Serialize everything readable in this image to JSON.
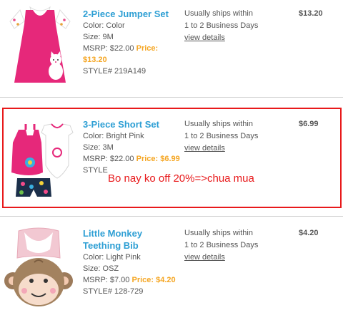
{
  "items": [
    {
      "title": "2-Piece Jumper Set",
      "color": "Color: Color",
      "size": "Size: 9M",
      "msrp": "MSRP: $22.00",
      "price_label": "Price:",
      "price_value": "$13.20",
      "style": "STYLE# 219A149",
      "ship_line1": "Usually ships within",
      "ship_line2": "1 to 2 Business Days",
      "details": "view details",
      "total": "$13.20"
    },
    {
      "title": "3-Piece Short Set",
      "color": "Color: Bright Pink",
      "size": "Size: 3M",
      "msrp": "MSRP: $22.00",
      "price_label": "Price:",
      "price_value": "$6.99",
      "style": "STYLE",
      "ship_line1": "Usually ships within",
      "ship_line2": "1 to 2 Business Days",
      "details": "view details",
      "total": "$6.99"
    },
    {
      "title_line1": "Little Monkey",
      "title_line2": "Teething Bib",
      "color": "Color: Light Pink",
      "size": "Size: OSZ",
      "msrp": "MSRP: $7.00",
      "price_label": "Price:",
      "price_value": "$4.20",
      "style": "STYLE# 128-729",
      "ship_line1": "Usually ships within",
      "ship_line2": "1 to 2 Business Days",
      "details": "view details",
      "total": "$4.20"
    }
  ],
  "annotation": {
    "text": "Bo nay ko off 20%=>chua mua",
    "color": "#e8191b"
  },
  "colors": {
    "title": "#2e9fd4",
    "price": "#f5a623",
    "text": "#555555"
  }
}
